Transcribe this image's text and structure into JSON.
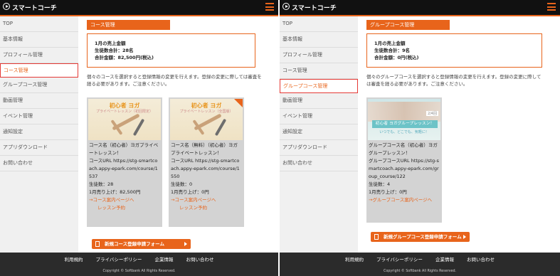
{
  "left": {
    "app_name": "スマートコーチ",
    "sidebar": [
      "TOP",
      "基本情報",
      "プロフィール管理",
      "コース管理",
      "グループコース管理",
      "動画管理",
      "イベント管理",
      "通知設定",
      "アプリダウンロード",
      "お問い合わせ"
    ],
    "active_index": 3,
    "section_title": "コース管理",
    "summary": {
      "line1": "1月の売上金額",
      "line2": "生徒数合計：28名",
      "line3": "合計金額：82,500円(税込)"
    },
    "description": "個々のコースを選択すると登録情報の変更を行えます。登録の変更に際しては審査を経る必要があります。ご注意ください。",
    "cards": [
      {
        "thumb_caption": "初心者 ヨガ",
        "thumb_sub": "プライベートレッスン（初回限定）",
        "line1": "コース名（初心者）ヨガプライベートレッスン！",
        "line2": "コースURL https://stg-smartcoach.appy-epark.com/course/1537",
        "line3": "生徒数：28",
        "line4": "1月売り上げ：82,500円",
        "link1": "→コース案内ページへ",
        "link2": "レッスン予約"
      },
      {
        "thumb_caption": "初心者 ヨガ",
        "thumb_sub": "プライベートレッスン（全国版）",
        "line1": "コース名（無料）（初心者）ヨガプライベートレッスン！",
        "line2": "コースURL https://stg-smartcoach.appy-epark.com/course/1550",
        "line3": "生徒数：0",
        "line4": "1月売り上げ：0円",
        "link1": "→コース案内ページへ",
        "link2": "レッスン予約"
      }
    ],
    "cta": "新規コース登録申請フォーム"
  },
  "right": {
    "app_name": "スマートコーチ",
    "sidebar": [
      "TOP",
      "基本情報",
      "プロフィール管理",
      "コース管理",
      "グループコース管理",
      "動画管理",
      "イベント管理",
      "通知設定",
      "アプリダウンロード",
      "お問い合わせ"
    ],
    "active_index": 4,
    "section_title": "グループコース管理",
    "summary": {
      "line1": "1月の売上金額",
      "line2": "生徒数合計：9名",
      "line3": "合計金額：0円(税込)"
    },
    "description": "個々のグループコースを選択すると登録情報の変更を行えます。登録の変更に際しては審査を経る必要があります。ご注意ください。",
    "card": {
      "badge": "2/4回",
      "banner": "初心者 ヨガグループレッスン！",
      "banner2": "いつでも、どこでも、気軽に！",
      "line1": "グループコース名（初心者）ヨガグループレッスン！",
      "line2": "グループコースURL https://stg-smartcoach.appy-epark.com/group_course/122",
      "line3": "生徒数：4",
      "line4": "1月売り上げ：0円",
      "link1": "→グループコース案内ページへ"
    },
    "cta": "新規グループコース登録申請フォーム"
  },
  "footer": {
    "links": [
      "利用規約",
      "プライバシーポリシー",
      "企業情報",
      "お問い合わせ"
    ],
    "copyright": "Copyright © Softbank All Rights Reserved."
  },
  "colors": {
    "accent": "#e8641b",
    "header": "#111111",
    "footer": "#2b2b2b",
    "active_border": "#e53935"
  }
}
